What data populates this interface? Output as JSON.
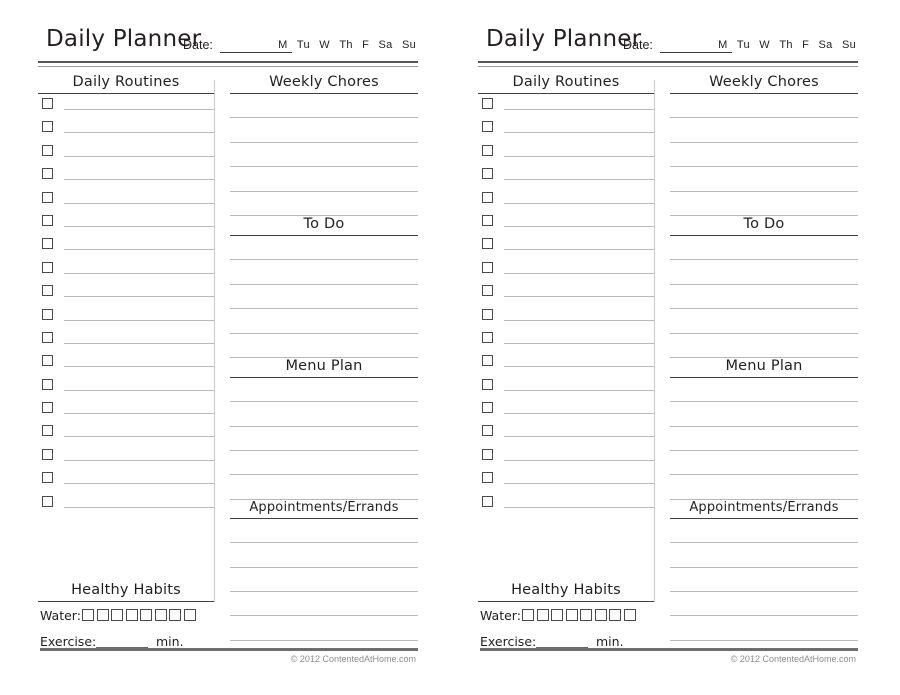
{
  "page": {
    "copyright": "© 2012 ContentedAtHome.com"
  },
  "planner": {
    "title": "Daily Planner",
    "date_label": "Date:",
    "days": [
      "M",
      "Tu",
      "W",
      "Th",
      "F",
      "Sa",
      "Su"
    ],
    "routines": {
      "heading": "Daily Routines",
      "row_count": 18
    },
    "sections": [
      {
        "heading": "Weekly Chores",
        "line_count": 5
      },
      {
        "heading": "To Do",
        "line_count": 5
      },
      {
        "heading": "Menu Plan",
        "line_count": 5
      },
      {
        "heading": "Appointments/Errands",
        "line_count": 5
      }
    ],
    "habits": {
      "heading": "Healthy Habits",
      "water_label": "Water:",
      "water_boxes": 8,
      "exercise_label": "Exercise:",
      "exercise_unit": "min."
    }
  }
}
